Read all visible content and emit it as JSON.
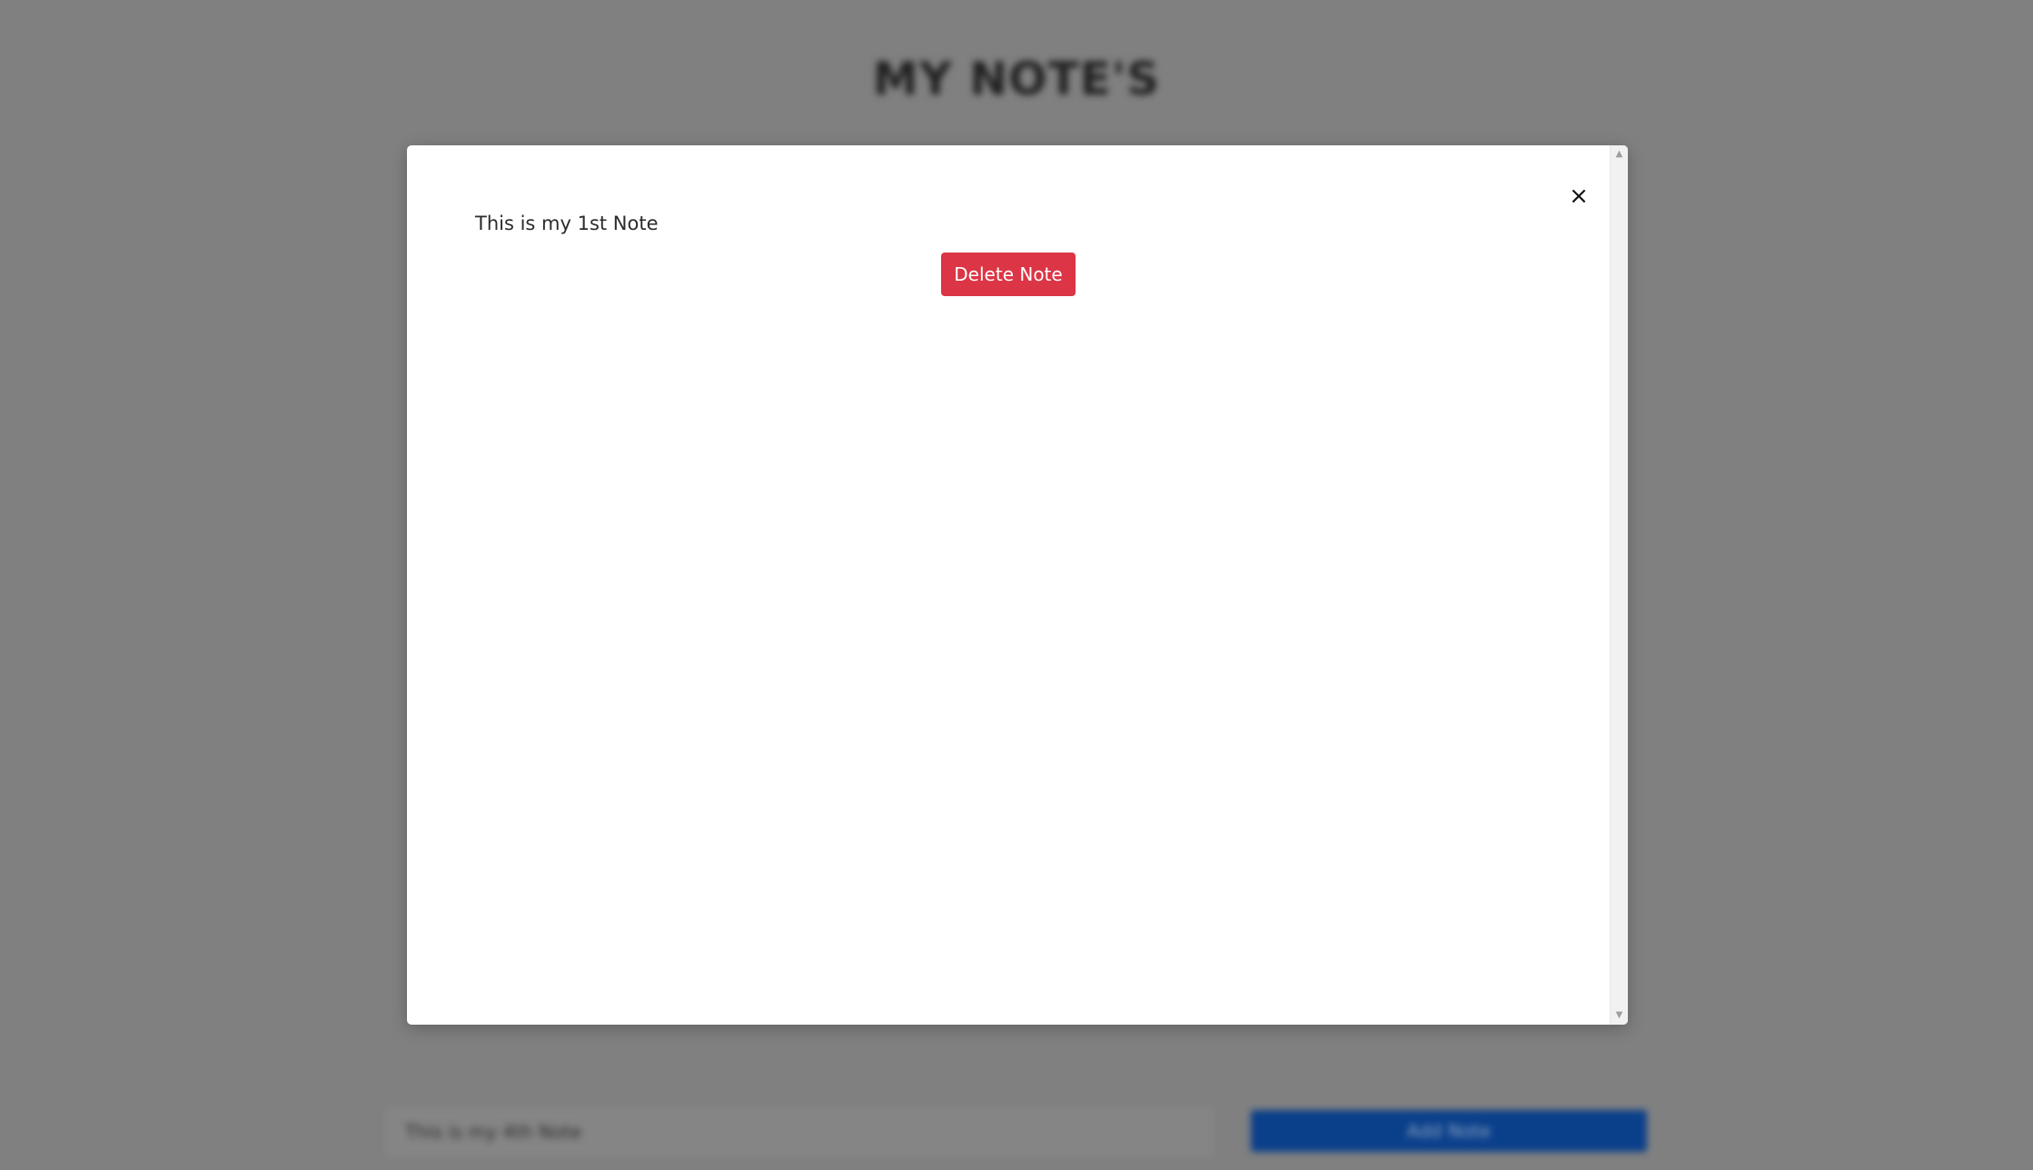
{
  "background": {
    "page_title": "MY NOTE'S",
    "note_input": {
      "value": "This is my 4th Note",
      "placeholder": ""
    },
    "add_button_label": "Add Note"
  },
  "modal": {
    "close_glyph": "×",
    "note_text": "This is my 1st Note",
    "delete_button_label": "Delete Note"
  },
  "scrollbar": {
    "up_glyph": "▲",
    "down_glyph": "▼"
  },
  "colors": {
    "overlay": "#808080",
    "delete": "#dc3545",
    "add": "#0a3f8a",
    "modal_bg": "#ffffff"
  },
  "icons": {
    "close": "close-icon",
    "scroll_up": "scroll-up-arrow-icon",
    "scroll_down": "scroll-down-arrow-icon"
  }
}
